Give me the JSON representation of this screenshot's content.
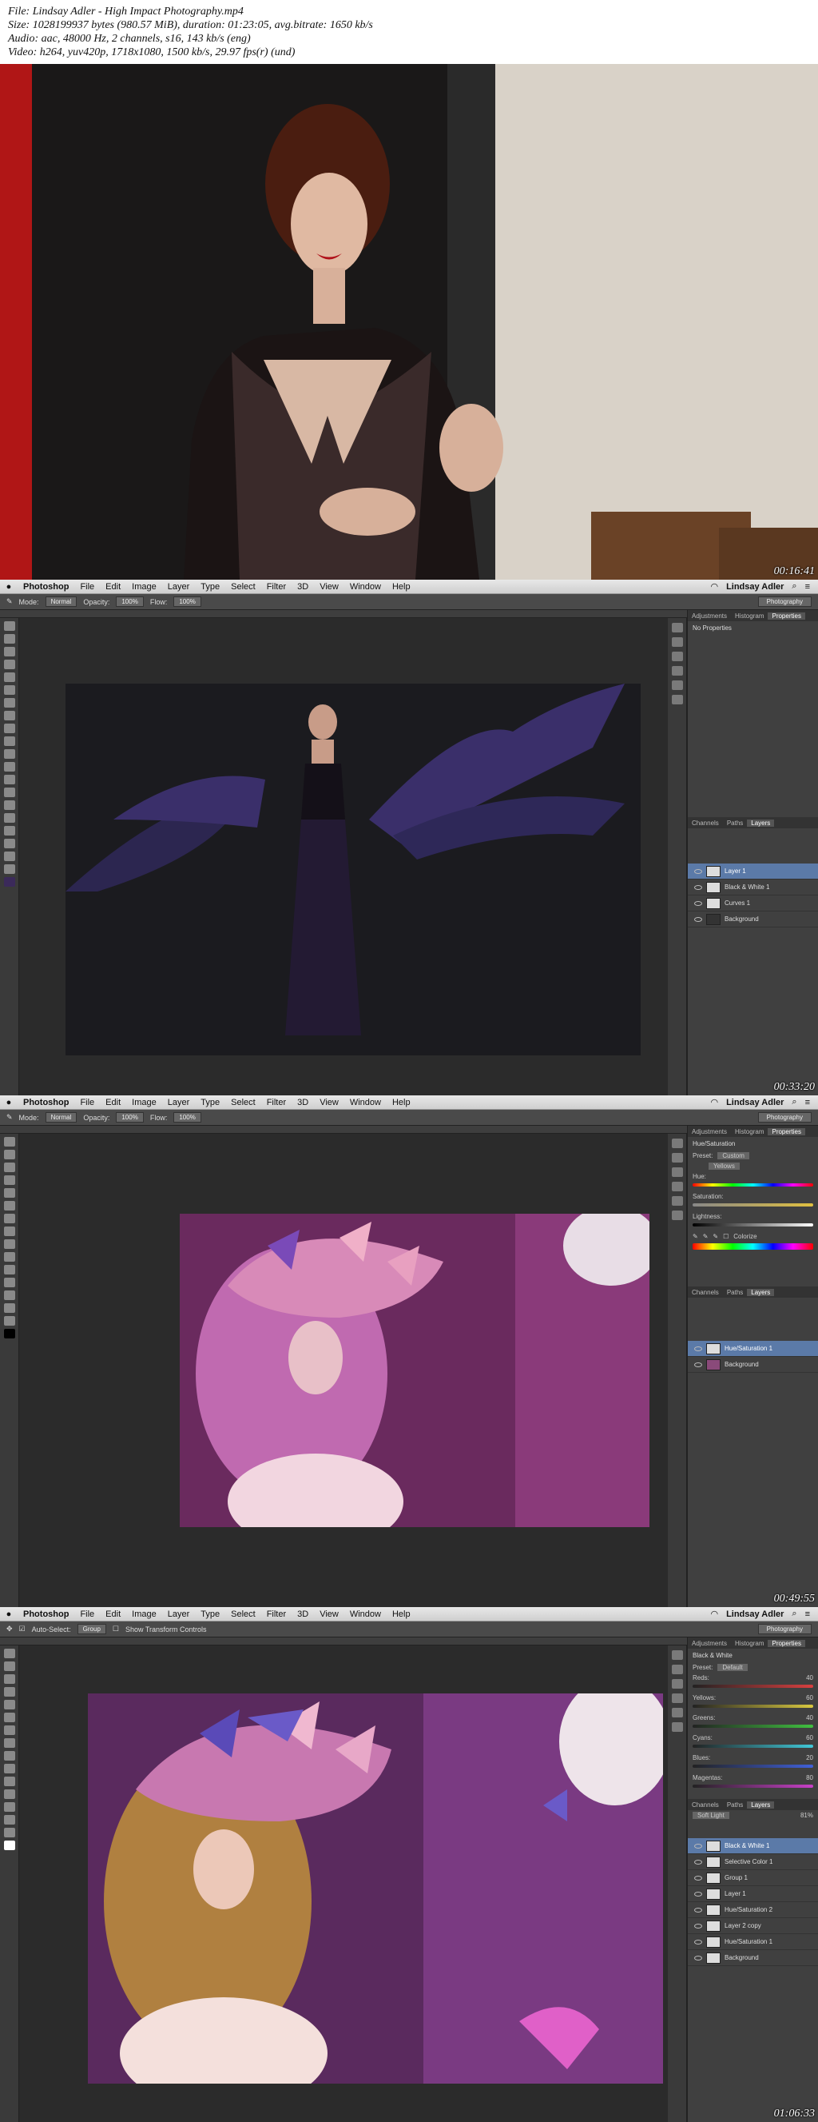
{
  "header": {
    "lines": [
      "File: Lindsay Adler - High Impact Photography.mp4",
      "Size: 1028199937 bytes (980.57 MiB), duration: 01:23:05, avg.bitrate: 1650 kb/s",
      "Audio: aac, 48000 Hz, 2 channels, s16, 143 kb/s (eng)",
      "Video: h264, yuv420p, 1718x1080, 1500 kb/s, 29.97 fps(r) (und)"
    ]
  },
  "frames": [
    {
      "timestamp": "00:16:41"
    },
    {
      "timestamp": "00:33:20",
      "menu": [
        "Photoshop",
        "File",
        "Edit",
        "Image",
        "Layer",
        "Type",
        "Select",
        "Filter",
        "3D",
        "View",
        "Window",
        "Help"
      ],
      "user": "Lindsay Adler",
      "workspace": "Photography",
      "options": {
        "mode_label": "Mode:",
        "mode": "Normal",
        "opacity_label": "Opacity:",
        "opacity": "100%",
        "flow_label": "Flow:",
        "flow": "100%"
      },
      "panel_tabs": [
        "Adjustments",
        "Histogram",
        "Properties"
      ],
      "properties_title": "No Properties",
      "layers_tabs": [
        "Channels",
        "Paths",
        "Layers"
      ],
      "layers": [
        {
          "name": "Layer 1",
          "selected": true
        },
        {
          "name": "Black & White 1",
          "selected": false
        },
        {
          "name": "Curves 1",
          "selected": false
        },
        {
          "name": "Background",
          "selected": false
        }
      ]
    },
    {
      "timestamp": "00:49:55",
      "menu": [
        "Photoshop",
        "File",
        "Edit",
        "Image",
        "Layer",
        "Type",
        "Select",
        "Filter",
        "3D",
        "View",
        "Window",
        "Help"
      ],
      "user": "Lindsay Adler",
      "workspace": "Photography",
      "options": {
        "mode_label": "Mode:",
        "mode": "Normal",
        "opacity_label": "Opacity:",
        "opacity": "100%",
        "flow_label": "Flow:",
        "flow": "100%"
      },
      "panel_tabs": [
        "Adjustments",
        "Histogram",
        "Properties"
      ],
      "properties_title": "Hue/Saturation",
      "preset_label": "Preset:",
      "preset": "Custom",
      "channel": "Yellows",
      "hue_label": "Hue:",
      "saturation_label": "Saturation:",
      "lightness_label": "Lightness:",
      "colorize_label": "Colorize",
      "layers_tabs": [
        "Channels",
        "Paths",
        "Layers"
      ],
      "layers": [
        {
          "name": "Hue/Saturation 1",
          "selected": true
        },
        {
          "name": "Background",
          "selected": false
        }
      ]
    },
    {
      "timestamp": "01:06:33",
      "menu": [
        "Photoshop",
        "File",
        "Edit",
        "Image",
        "Layer",
        "Type",
        "Select",
        "Filter",
        "3D",
        "View",
        "Window",
        "Help"
      ],
      "user": "Lindsay Adler",
      "workspace": "Photography",
      "options": {
        "auto_select": "Auto-Select:",
        "group": "Group",
        "show_transform": "Show Transform Controls"
      },
      "panel_tabs": [
        "Adjustments",
        "Histogram",
        "Properties"
      ],
      "properties_title": "Black & White",
      "preset_label": "Preset:",
      "preset": "Default",
      "sliders": [
        {
          "name": "Reds:",
          "value": "40",
          "color": "#d84040"
        },
        {
          "name": "Yellows:",
          "value": "60",
          "color": "#d8c840"
        },
        {
          "name": "Greens:",
          "value": "40",
          "color": "#40c040"
        },
        {
          "name": "Cyans:",
          "value": "60",
          "color": "#40c8d8"
        },
        {
          "name": "Blues:",
          "value": "20",
          "color": "#4060d8"
        },
        {
          "name": "Magentas:",
          "value": "80",
          "color": "#c840c8"
        }
      ],
      "layers_tabs": [
        "Channels",
        "Paths",
        "Layers"
      ],
      "blend_mode": "Soft Light",
      "opacity": "81%",
      "layers": [
        {
          "name": "Black & White 1",
          "selected": true
        },
        {
          "name": "Selective Color 1",
          "selected": false
        },
        {
          "name": "Group 1",
          "selected": false
        },
        {
          "name": "Layer 1",
          "selected": false
        },
        {
          "name": "Hue/Saturation 2",
          "selected": false
        },
        {
          "name": "Layer 2 copy",
          "selected": false
        },
        {
          "name": "Hue/Saturation 1",
          "selected": false
        },
        {
          "name": "Background",
          "selected": false
        }
      ]
    }
  ]
}
